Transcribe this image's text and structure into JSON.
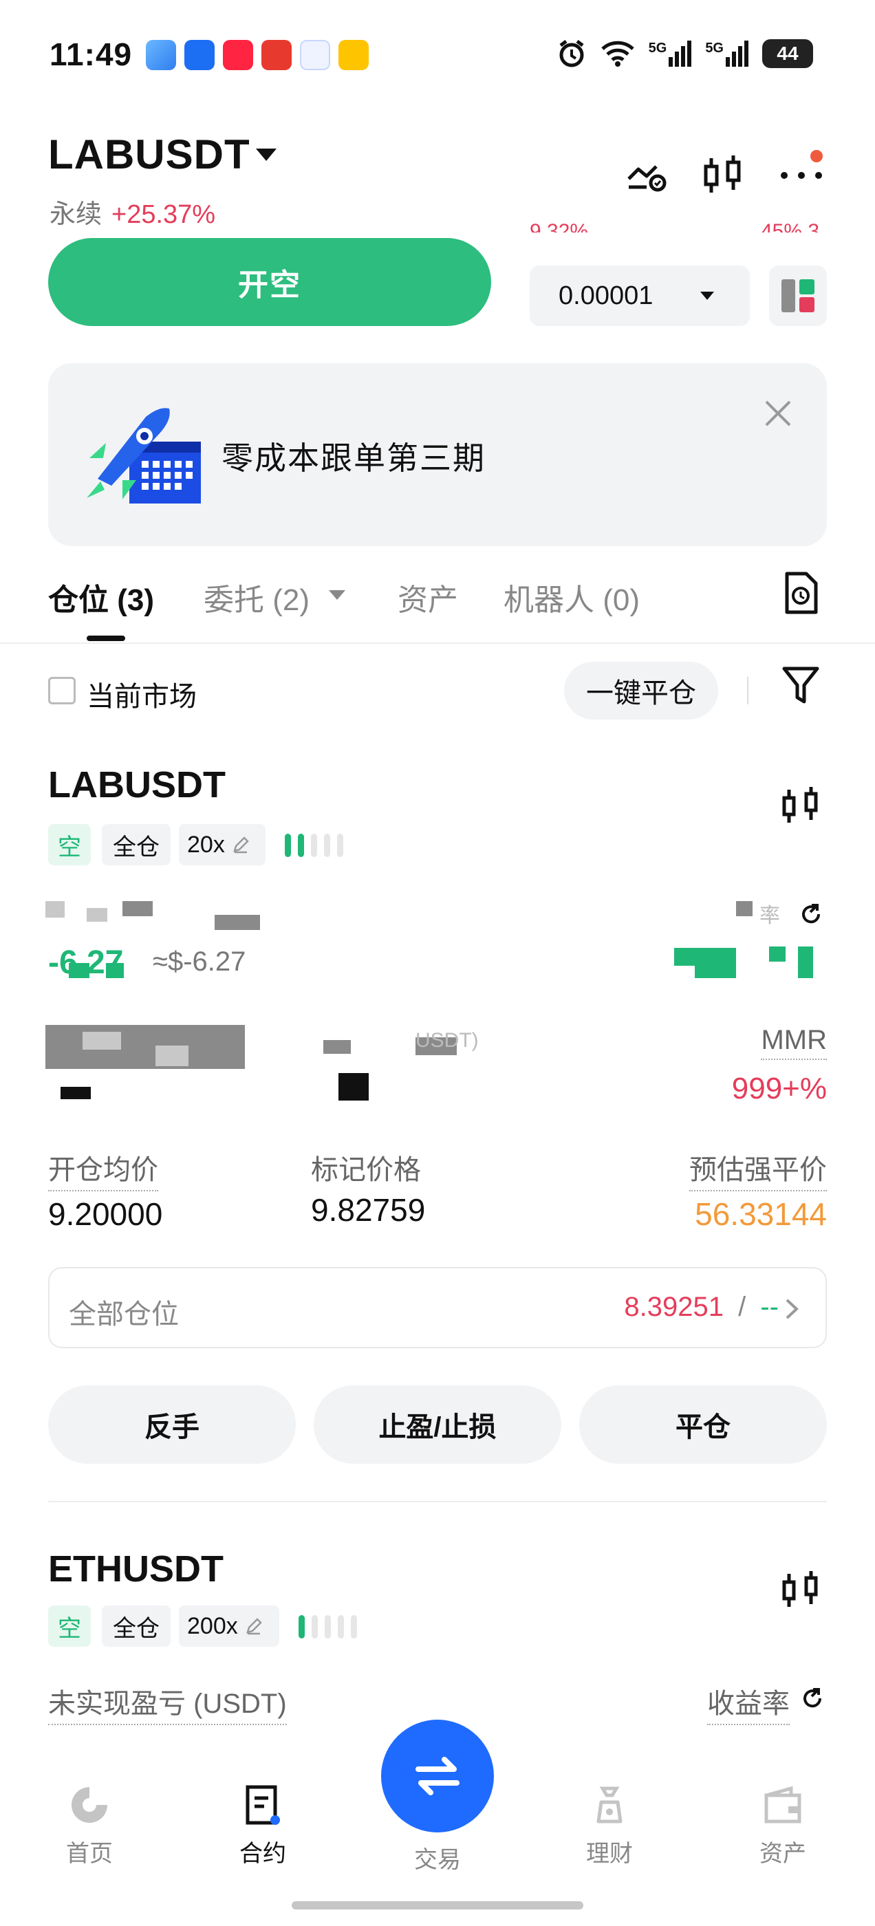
{
  "status_bar": {
    "time": "11:49",
    "battery": "44",
    "signal_1": "5G",
    "signal_2": "5G"
  },
  "header": {
    "pair": "LABUSDT",
    "contract_type": "永续",
    "change": "+25.37%",
    "clipped_left": "9 32%",
    "clipped_right": "45% 3"
  },
  "order": {
    "open_short_label": "开空",
    "precision_value": "0.00001"
  },
  "banner": {
    "text": "零成本跟单第三期"
  },
  "tabs": [
    {
      "label": "仓位 (3)"
    },
    {
      "label": "委托 (2)"
    },
    {
      "label": "资产"
    },
    {
      "label": "机器人 (0)"
    }
  ],
  "filter": {
    "current_market_label": "当前市场",
    "close_all_label": "一键平仓"
  },
  "positions": [
    {
      "symbol": "LABUSDT",
      "side": "空",
      "margin_mode": "全仓",
      "leverage": "20x",
      "pnl": "-6.27",
      "pnl_usd": "≈$-6.27",
      "pnl_unit_partial": "USDT)",
      "yield_label_partial": "率",
      "mmr_label": "MMR",
      "mmr_value": "999+%",
      "avg_open_label": "开仓均价",
      "avg_open_value": "9.20000",
      "mark_price_label": "标记价格",
      "mark_price_value": "9.82759",
      "liq_price_label": "预估强平价",
      "liq_price_value": "56.33144",
      "all_positions_label": "全部仓位",
      "all_positions_value": "8.39251",
      "all_positions_sep": "/",
      "all_positions_other": "--",
      "actions": [
        "反手",
        "止盈/止损",
        "平仓"
      ]
    },
    {
      "symbol": "ETHUSDT",
      "side": "空",
      "margin_mode": "全仓",
      "leverage": "200x",
      "pnl_label": "未实现盈亏 (USDT)",
      "yield_label": "收益率"
    }
  ],
  "bottom_nav": [
    {
      "label": "首页",
      "icon": "home-icon"
    },
    {
      "label": "合约",
      "icon": "contract-icon"
    },
    {
      "label": "交易",
      "icon": "swap-icon"
    },
    {
      "label": "理财",
      "icon": "finance-icon"
    },
    {
      "label": "资产",
      "icon": "wallet-icon"
    }
  ],
  "colors": {
    "accent_green": "#2dbd7e",
    "loss_red": "#e43d5b",
    "liq_orange": "#f29a3a",
    "trade_blue": "#1f6bff"
  }
}
